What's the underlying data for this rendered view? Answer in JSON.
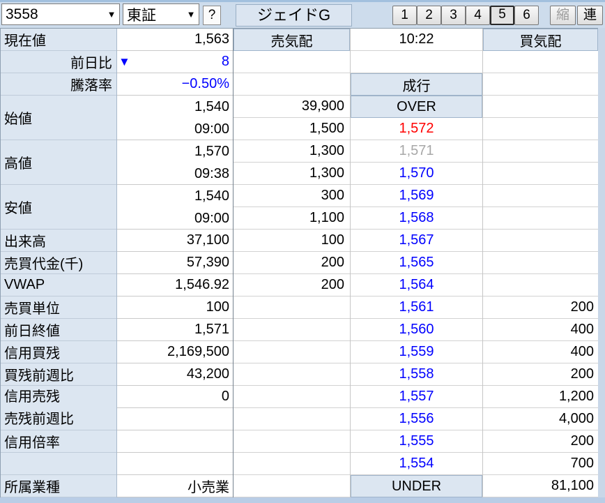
{
  "toolbar": {
    "code": "3558",
    "market": "東証",
    "help": "?",
    "stock_name": "ジェイドG",
    "page_buttons": [
      "1",
      "2",
      "3",
      "4",
      "5",
      "6"
    ],
    "active_page": "5",
    "shrink": "縮",
    "link": "連"
  },
  "icons": {
    "dropdown": "▼"
  },
  "quote": {
    "rows": [
      {
        "label": "現在値",
        "value": "1,563"
      },
      {
        "label": "前日比",
        "value": "8",
        "indicator": "▼"
      },
      {
        "label": "騰落率",
        "value": "−0.50%"
      },
      {
        "label": "始値",
        "value": "1,540",
        "time": "09:00"
      },
      {
        "label": "高値",
        "value": "1,570",
        "time": "09:38"
      },
      {
        "label": "安値",
        "value": "1,540",
        "time": "09:00"
      },
      {
        "label": "出来高",
        "value": "37,100"
      },
      {
        "label": "売買代金(千)",
        "value": "57,390"
      },
      {
        "label": "VWAP",
        "value": "1,546.92"
      },
      {
        "label": "売買単位",
        "value": "100"
      },
      {
        "label": "前日終値",
        "value": "1,571"
      },
      {
        "label": "信用買残",
        "value": "2,169,500"
      },
      {
        "label": "買残前週比",
        "value": "43,200"
      },
      {
        "label": "信用売残",
        "value": "0"
      },
      {
        "label": "売残前週比",
        "value": ""
      },
      {
        "label": "信用倍率",
        "value": ""
      },
      {
        "label": "",
        "value": ""
      },
      {
        "label": "所属業種",
        "value": "小売業"
      }
    ]
  },
  "board": {
    "sell_header": "売気配",
    "time": "10:22",
    "buy_header": "買気配",
    "market_order": "成行",
    "over": {
      "label": "OVER",
      "qty": "39,900"
    },
    "under": {
      "label": "UNDER",
      "qty": "81,100"
    },
    "asks": [
      {
        "price": "1,572",
        "qty": "1,500"
      },
      {
        "price": "1,571",
        "qty": "1,300"
      },
      {
        "price": "1,570",
        "qty": "1,300"
      },
      {
        "price": "1,569",
        "qty": "300"
      },
      {
        "price": "1,568",
        "qty": "1,100"
      },
      {
        "price": "1,567",
        "qty": "100"
      },
      {
        "price": "1,565",
        "qty": "200"
      },
      {
        "price": "1,564",
        "qty": "200"
      }
    ],
    "bids": [
      {
        "price": "1,561",
        "qty": "200"
      },
      {
        "price": "1,560",
        "qty": "400"
      },
      {
        "price": "1,559",
        "qty": "400"
      },
      {
        "price": "1,558",
        "qty": "200"
      },
      {
        "price": "1,557",
        "qty": "1,200"
      },
      {
        "price": "1,556",
        "qty": "4,000"
      },
      {
        "price": "1,555",
        "qty": "200"
      },
      {
        "price": "1,554",
        "qty": "700"
      }
    ]
  },
  "colors": {
    "up_price": "#ff0000",
    "down_price": "#0000ff",
    "prev_close_price": "#a8a8a8",
    "change_negative": "#0000ff",
    "panel_bg": "#dce6f1",
    "frame_bg": "#cddcec"
  }
}
